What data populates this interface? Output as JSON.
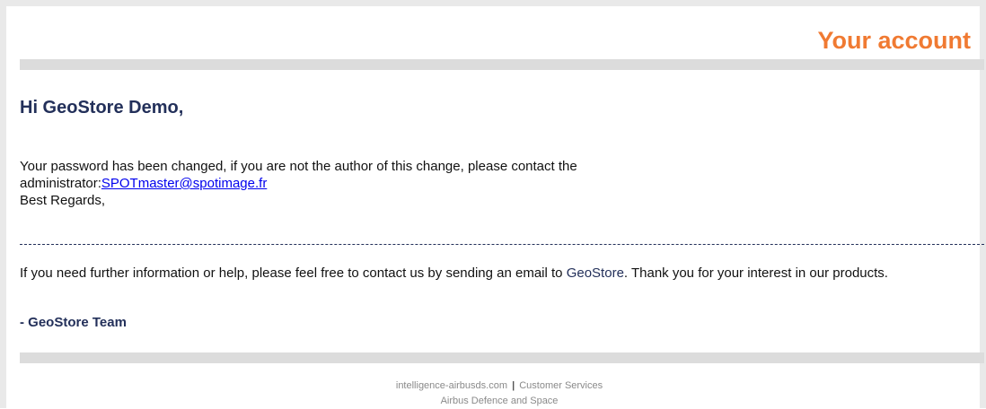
{
  "header": {
    "title": "Your account"
  },
  "greeting": "Hi  GeoStore Demo,",
  "message": {
    "line1": "Your password has been changed, if you are not the author of this change, please contact the",
    "line2_prefix": "administrator:",
    "admin_email": "SPOTmaster@spotimage.fr",
    "closing": "Best Regards,"
  },
  "help": {
    "text_before": "If you need further information or help, please feel free to contact us by sending an email to ",
    "brand_link": "GeoStore",
    "text_after": ". Thank you for your interest in our products."
  },
  "signature": "- GeoStore Team",
  "footer": {
    "site": "intelligence-airbusds.com",
    "separator": "|",
    "customer_services": "Customer Services",
    "company": "Airbus Defence and Space"
  },
  "colors": {
    "accent": "#f07a32",
    "brand_navy": "#23305a",
    "link": "#0000ee",
    "bar_gray": "#dcdcdc"
  }
}
